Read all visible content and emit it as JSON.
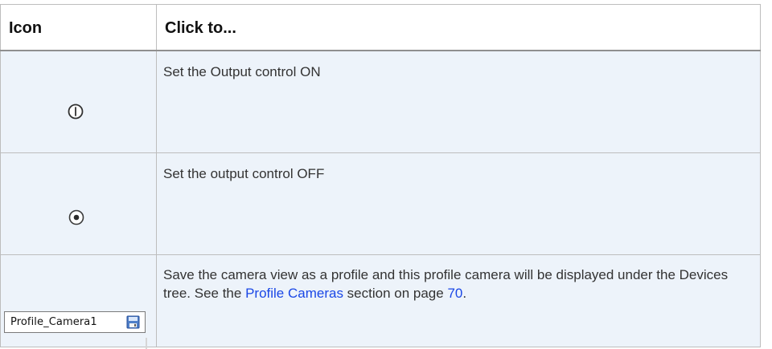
{
  "header": {
    "col_icon": "Icon",
    "col_action": "Click to..."
  },
  "rows": [
    {
      "icon": "output-on-icon",
      "text": "Set the Output control ON"
    },
    {
      "icon": "output-off-icon",
      "text": "Set the output control OFF"
    },
    {
      "icon": "save-profile-icon",
      "field_value": "Profile_Camera1",
      "text_before": "Save the camera view as a profile and this profile camera will be displayed under the Devices tree. See the",
      "link_text": "Profile Cameras",
      "text_middle": " section on page",
      "page_link": "70",
      "text_end": "."
    }
  ],
  "colors": {
    "row_bg": "#edf3fa",
    "border": "#bdbdbd",
    "header_text": "#111111",
    "body_text": "#333333",
    "link": "#1a47e6"
  }
}
